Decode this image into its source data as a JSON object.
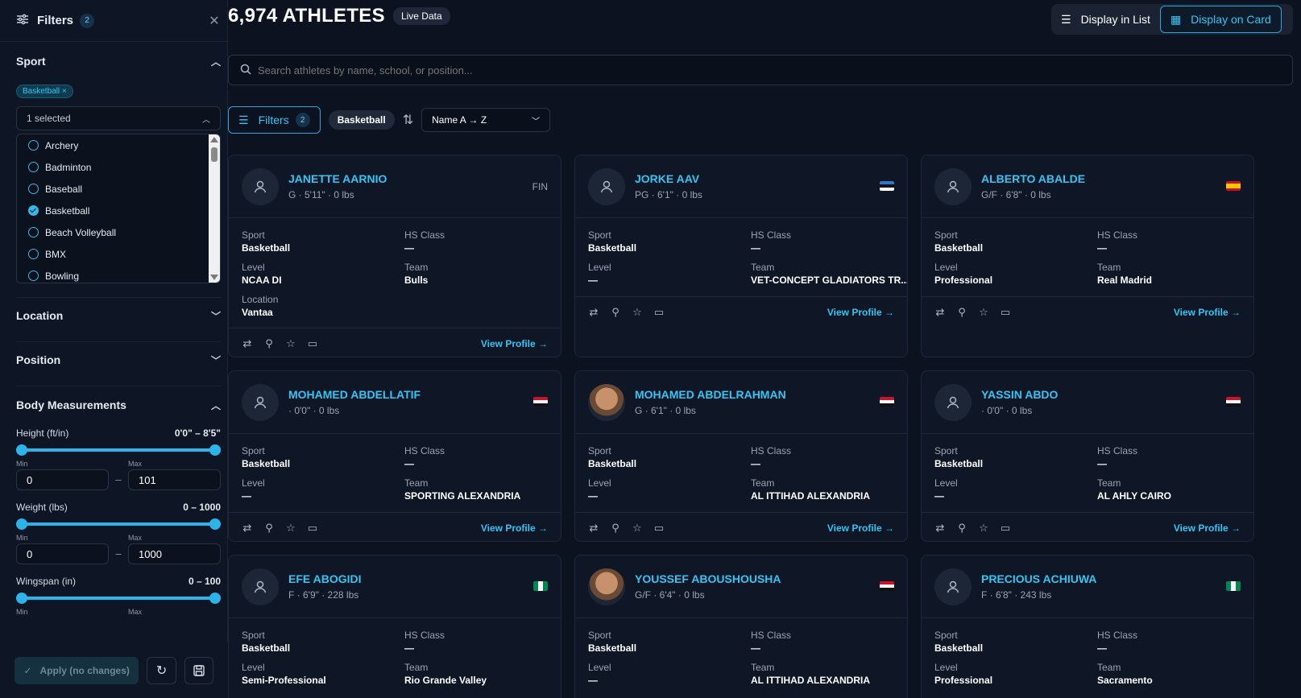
{
  "sidebar": {
    "title": "Filters",
    "count": "2",
    "sport": {
      "title": "Sport",
      "tag": "Basketball ×",
      "select_label": "1 selected",
      "options": [
        {
          "label": "Archery",
          "checked": false
        },
        {
          "label": "Badminton",
          "checked": false
        },
        {
          "label": "Baseball",
          "checked": false
        },
        {
          "label": "Basketball",
          "checked": true
        },
        {
          "label": "Beach Volleyball",
          "checked": false
        },
        {
          "label": "BMX",
          "checked": false
        },
        {
          "label": "Bowling",
          "checked": false
        }
      ]
    },
    "location": {
      "title": "Location"
    },
    "position": {
      "title": "Position"
    },
    "body": {
      "title": "Body Measurements",
      "height": {
        "label": "Height (ft/in)",
        "range": "0'0\" – 8'5\"",
        "min_label": "Min",
        "max_label": "Max",
        "min": "0",
        "max": "101"
      },
      "weight": {
        "label": "Weight (lbs)",
        "range": "0 – 1000",
        "min_label": "Min",
        "max_label": "Max",
        "min": "0",
        "max": "1000"
      },
      "wingspan": {
        "label": "Wingspan (in)",
        "range": "0 – 100",
        "min_label": "Min",
        "max_label": "Max"
      }
    },
    "apply_label": "Apply (no changes)"
  },
  "header": {
    "count_title": "6,974 ATHLETES",
    "live_badge": "Live Data",
    "list_label": "Display in List",
    "card_label": "Display on Card"
  },
  "search": {
    "placeholder": "Search athletes by name, school, or position..."
  },
  "toolbar": {
    "filters_label": "Filters",
    "filters_count": "2",
    "chip": "Basketball",
    "sort_value": "Name A → Z"
  },
  "cards": [
    {
      "name": "JANETTE AARNIO",
      "meta": "G  ·  5'11\" · 0 lbs",
      "country": "FIN",
      "sport": "Basketball",
      "hs_class": "—",
      "level": "NCAA DI",
      "team": "Bulls",
      "location": "Vantaa",
      "view": "View Profile →"
    },
    {
      "name": "JORKE AAV",
      "meta": "PG  ·  6'1\" · 0 lbs",
      "sport": "Basketball",
      "hs_class": "—",
      "level": "—",
      "team": "VET-CONCEPT GLADIATORS TR...",
      "view": "View Profile →"
    },
    {
      "name": "ALBERTO ABALDE",
      "meta": "G/F  ·  6'8\" · 0 lbs",
      "sport": "Basketball",
      "hs_class": "—",
      "level": "Professional",
      "team": "Real Madrid",
      "view": "View Profile →"
    },
    {
      "name": "MOHAMED ABDELLATIF",
      "meta": "·  0'0\" · 0 lbs",
      "sport": "Basketball",
      "hs_class": "—",
      "level": "—",
      "team": "SPORTING ALEXANDRIA",
      "view": "View Profile →"
    },
    {
      "name": "MOHAMED ABDELRAHMAN",
      "meta": "G  ·  6'1\" · 0 lbs",
      "sport": "Basketball",
      "hs_class": "—",
      "level": "—",
      "team": "AL ITTIHAD ALEXANDRIA",
      "view": "View Profile →"
    },
    {
      "name": "YASSIN ABDO",
      "meta": "·  0'0\" · 0 lbs",
      "sport": "Basketball",
      "hs_class": "—",
      "level": "—",
      "team": "AL AHLY CAIRO",
      "view": "View Profile →"
    },
    {
      "name": "EFE ABOGIDI",
      "meta": "F  ·  6'9\" · 228 lbs",
      "sport": "Basketball",
      "hs_class": "—",
      "level": "Semi-Professional",
      "team": "Rio Grande Valley"
    },
    {
      "name": "YOUSSEF ABOUSHOUSHA",
      "meta": "G/F  ·  6'4\" · 0 lbs",
      "sport": "Basketball",
      "hs_class": "—",
      "level": "—",
      "team": "AL ITTIHAD ALEXANDRIA"
    },
    {
      "name": "PRECIOUS ACHIUWA",
      "meta": "F  ·  6'8\" · 243 lbs",
      "sport": "Basketball",
      "hs_class": "—",
      "level": "Professional",
      "team": "Sacramento"
    }
  ],
  "labels": {
    "sport": "Sport",
    "hs_class": "HS Class",
    "level": "Level",
    "team": "Team",
    "location": "Location"
  }
}
